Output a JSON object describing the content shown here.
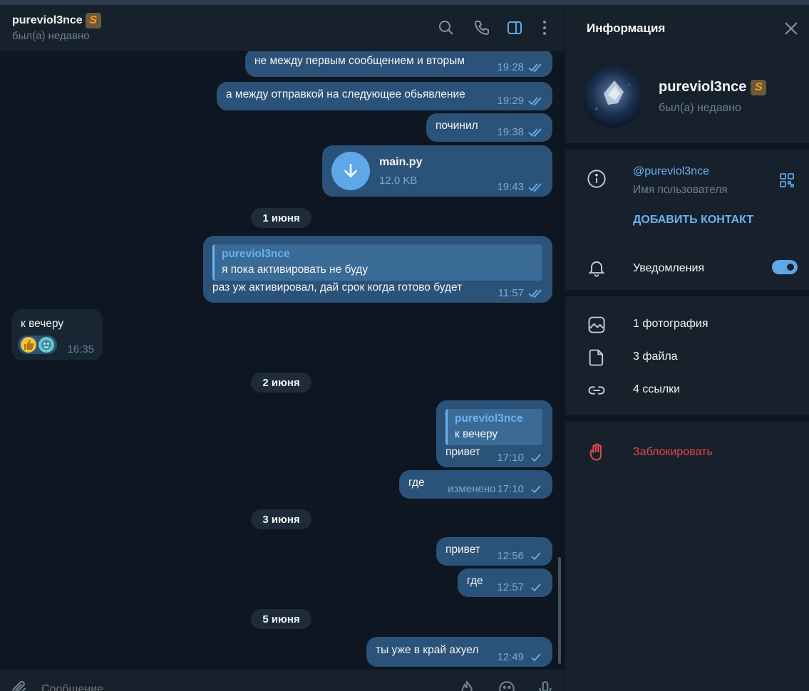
{
  "chat": {
    "peer_name": "pureviol3nce",
    "peer_badge": "S",
    "peer_status": "был(а) недавно",
    "composer_placeholder": "Сообщение"
  },
  "messages": [
    {
      "id": "m1",
      "direction": "out",
      "text": "не между первым сообщением и вторым",
      "time": "19:28",
      "status": "read"
    },
    {
      "id": "m2",
      "direction": "out",
      "text": "а между отправкой на следующее обьявление",
      "time": "19:29",
      "status": "read"
    },
    {
      "id": "m3",
      "direction": "out",
      "text": "починил",
      "time": "19:38",
      "status": "read"
    },
    {
      "id": "m4",
      "direction": "out",
      "file_name": "main.py",
      "file_size": "12.0 KB",
      "time": "19:43",
      "status": "read"
    },
    {
      "id": "d1",
      "date": "1 июня"
    },
    {
      "id": "m5",
      "direction": "out",
      "reply_name": "pureviol3nce",
      "reply_text": "я пока активировать не буду",
      "text": "раз уж активировал, дай срок когда готово будет",
      "time": "11:57",
      "status": "read"
    },
    {
      "id": "m6",
      "direction": "in",
      "text": "к вечеру",
      "time": "16:35",
      "reactions": [
        "thumbs-up",
        "sticker"
      ]
    },
    {
      "id": "d2",
      "date": "2 июня"
    },
    {
      "id": "m7",
      "direction": "out",
      "reply_name": "pureviol3nce",
      "reply_text": "к вечеру",
      "text": "привет",
      "time": "17:10",
      "status": "sent"
    },
    {
      "id": "m8",
      "direction": "out",
      "text": "где",
      "edited": "изменено",
      "time": "17:10",
      "status": "sent"
    },
    {
      "id": "d3",
      "date": "3 июня"
    },
    {
      "id": "m9",
      "direction": "out",
      "text": "привет",
      "time": "12:56",
      "status": "sent"
    },
    {
      "id": "m10",
      "direction": "out",
      "text": "где",
      "time": "12:57",
      "status": "sent"
    },
    {
      "id": "d4",
      "date": "5 июня"
    },
    {
      "id": "m11",
      "direction": "out",
      "text": "ты уже в край ахуел",
      "time": "12:49",
      "status": "sent"
    }
  ],
  "info": {
    "title": "Информация",
    "name": "pureviol3nce",
    "badge": "S",
    "status": "был(а) недавно",
    "username": "@pureviol3nce",
    "username_label": "Имя пользователя",
    "add_contact": "ДОБАВИТЬ КОНТАКТ",
    "notifications": "Уведомления",
    "notifications_on": true,
    "photos": "1 фотография",
    "files": "3 файла",
    "links": "4 ссылки",
    "block": "Заблокировать"
  },
  "colors": {
    "bg": "#0e1621",
    "panel": "#17212b",
    "outgoing": "#2b5278",
    "incoming": "#182533",
    "accent": "#6ab2f2",
    "danger": "#e5484d",
    "badge": "#f39a1c"
  },
  "icons": [
    "search-icon",
    "phone-icon",
    "sidebar-toggle-icon",
    "more-icon",
    "close-icon",
    "info-icon",
    "qr-code-icon",
    "bell-icon",
    "photo-icon",
    "file-icon",
    "link-icon",
    "hand-block-icon",
    "attach-icon",
    "emoji-icon",
    "mic-icon",
    "download-icon",
    "double-check-icon",
    "check-icon"
  ]
}
